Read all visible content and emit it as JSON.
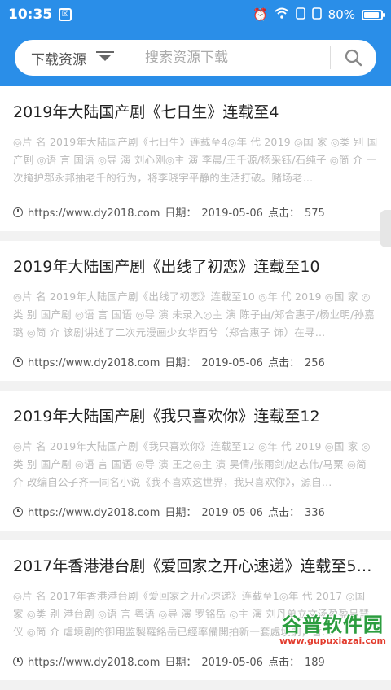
{
  "status_bar": {
    "time": "10:35",
    "battery": "80%",
    "icons": [
      "alarm-icon",
      "wifi-icon",
      "signal-icon",
      "sim-icon",
      "battery-icon"
    ]
  },
  "search": {
    "category_label": "下载资源",
    "placeholder": "搜索资源下载"
  },
  "items": [
    {
      "title": "2019年大陆国产剧《七日生》连载至4",
      "desc": "◎片 名 2019年大陆国产剧《七日生》连载至4◎年 代 2019 ◎国 家 ◎类 别 国产剧 ◎语 言 国语 ◎导 演 刘心刚◎主 演 李晨/王千源/杨采钰/石纯子 ◎简 介 一次掩护郡永邦抽老千的行为，将李晓宇平静的生活打破。赌场老…",
      "url": "https://www.dy2018.com",
      "date_label": "日期：",
      "date": "2019-05-06",
      "hits_label": "点击：",
      "hits": "575"
    },
    {
      "title": "2019年大陆国产剧《出线了初恋》连载至10",
      "desc": "◎片 名 2019年大陆国产剧《出线了初恋》连载至10 ◎年 代 2019 ◎国 家 ◎类 别 国产剧 ◎语 言 国语 ◎导 演 未录入◎主 演 陈子由/郑合惠子/杨业明/孙嘉璐 ◎简 介 该剧讲述了二次元漫画少女华西兮（郑合惠子 饰）在寻…",
      "url": "https://www.dy2018.com",
      "date_label": "日期：",
      "date": "2019-05-06",
      "hits_label": "点击：",
      "hits": "256"
    },
    {
      "title": "2019年大陆国产剧《我只喜欢你》连载至12",
      "desc": "◎片 名 2019年大陆国产剧《我只喜欢你》连载至12 ◎年 代 2019 ◎国 家 ◎类 别 国产剧 ◎语 言 国语 ◎导 演 王之◎主 演 吴倩/张雨剑/赵志伟/马栗 ◎简 介 改编自公子齐一同名小说《我不喜欢这世界，我只喜欢你》，源自…",
      "url": "https://www.dy2018.com",
      "date_label": "日期：",
      "date": "2019-05-06",
      "hits_label": "点击：",
      "hits": "336"
    },
    {
      "title": "2017年香港港台剧《爱回家之开心速递》连载至5…",
      "desc": "◎片 名 2017年香港港台剧《爱回家之开心速递》连载至1◎年 代 2017 ◎国 家 ◎类 别 港台剧 ◎语 言 粤语 ◎导 演 罗铭岳 ◎主 演 刘丹单立文汤盈盈吕慧仪 ◎简 介 虐境剧的御用监製羅銘岳已經率備開拍新一套處境劇，暫…",
      "url": "https://www.dy2018.com",
      "date_label": "日期：",
      "date": "2019-05-06",
      "hits_label": "点击：",
      "hits": "189"
    }
  ],
  "watermark": {
    "name": "谷普软件园",
    "url": "www.gupuxiazai.com"
  },
  "colors": {
    "header": "#2a8ee8",
    "background": "#f2f2f2",
    "watermark_green": "#2c9d3f",
    "watermark_red": "#e23c2e"
  }
}
